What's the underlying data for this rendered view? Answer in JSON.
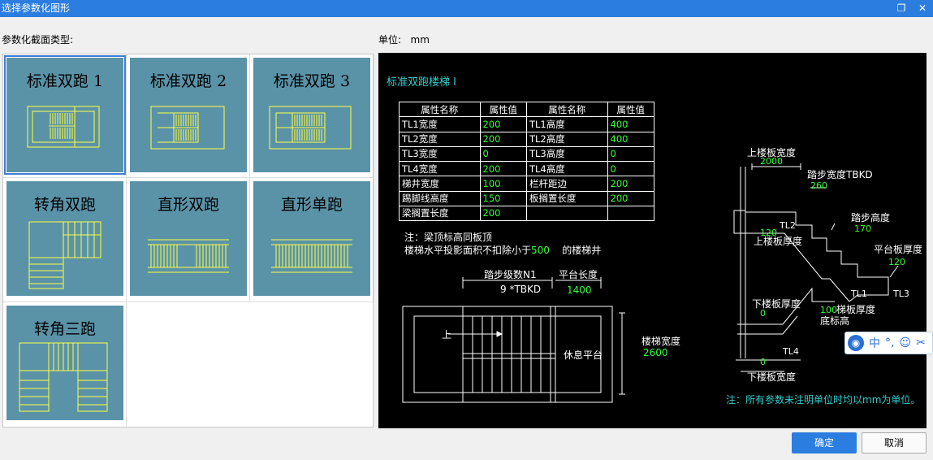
{
  "window": {
    "title": "选择参数化图形",
    "restore_glyph": "❐",
    "close_glyph": "✕"
  },
  "left_label": "参数化截面类型:",
  "unit": {
    "label": "单位:",
    "value": "mm"
  },
  "tiles": [
    {
      "name": "标准双跑 1",
      "selected": true
    },
    {
      "name": "标准双跑 2",
      "selected": false
    },
    {
      "name": "标准双跑 3",
      "selected": false
    },
    {
      "name": "转角双跑",
      "selected": false
    },
    {
      "name": "直形双跑",
      "selected": false
    },
    {
      "name": "直形单跑",
      "selected": false
    },
    {
      "name": "转角三跑",
      "selected": false
    }
  ],
  "preview": {
    "title": "标准双跑楼梯 I",
    "table_headers": [
      "属性名称",
      "属性值",
      "属性名称",
      "属性值"
    ],
    "table_rows": [
      [
        "TL1宽度",
        "200",
        "TL1高度",
        "400"
      ],
      [
        "TL2宽度",
        "200",
        "TL2高度",
        "400"
      ],
      [
        "TL3宽度",
        "0",
        "TL3高度",
        "0"
      ],
      [
        "TL4宽度",
        "200",
        "TL4高度",
        "0"
      ],
      [
        "梯井宽度",
        "100",
        "栏杆距边",
        "200"
      ],
      [
        "踢脚线高度",
        "150",
        "板搁置长度",
        "200"
      ],
      [
        "梁搁置长度",
        "200",
        "",
        ""
      ]
    ],
    "note1": "注：梁顶标高同板顶",
    "note2_a": "楼梯水平投影面积不扣除小于",
    "note2_val": "500",
    "note2_b": "的楼梯井",
    "plan": {
      "steps_label": "踏步级数N1",
      "steps_value": "9  *TBKD",
      "platform_label": "平台长度",
      "platform_value": "1400",
      "up_label": "上",
      "rest_label": "休息平台",
      "width_label": "楼梯宽度",
      "width_value": "2600"
    },
    "section": {
      "top_slab_width_label": "上楼板宽度",
      "top_slab_width_value": "2000",
      "tread_width_label": "踏步宽度TBKD",
      "tread_width_value": "260",
      "tread_height_label": "踏步高度",
      "tread_height_value": "170",
      "tl2": "TL2",
      "val_120a": "120",
      "top_slab_thick_label": "上楼板厚度",
      "platform_thick_label": "平台板厚度",
      "val_120b": "120",
      "tl1": "TL1",
      "tl3": "TL3",
      "bottom_slab_thick_label": "下楼板厚度",
      "val_0a": "0",
      "val_100": "100",
      "stair_thick_label": "梯板厚度",
      "bottom_elev_label": "底标高",
      "tl4": "TL4",
      "val_0b": "0",
      "bottom_slab_width_label": "下楼板宽度"
    },
    "footer_note": "注：所有参数未注明单位时均以mm为单位。"
  },
  "ime": {
    "label": "中",
    "punct": "°,",
    "emoji": "☺",
    "tool": "✂"
  },
  "buttons": {
    "ok": "确定",
    "cancel": "取消"
  }
}
